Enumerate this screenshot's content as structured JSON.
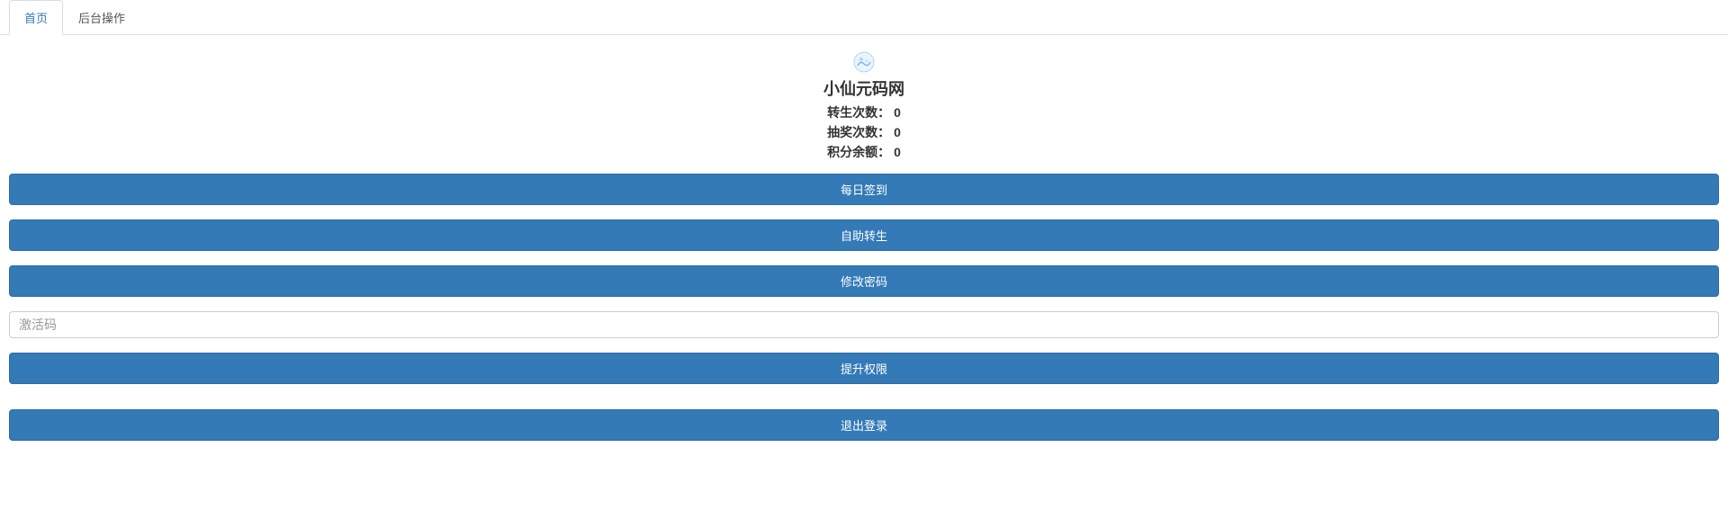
{
  "tabs": {
    "home_label": "首页",
    "admin_label": "后台操作"
  },
  "logo": {
    "name": "site-logo-icon"
  },
  "site_title": "小仙元码网",
  "stats": {
    "rebirth_label": "转生次数：",
    "rebirth_value": "0",
    "lottery_label": "抽奖次数：",
    "lottery_value": "0",
    "points_label": "积分余额：",
    "points_value": "0"
  },
  "buttons": {
    "daily_checkin": "每日签到",
    "self_rebirth": "自助转生",
    "change_password": "修改密码",
    "upgrade_privilege": "提升权限",
    "logout": "退出登录"
  },
  "inputs": {
    "activation_code_placeholder": "激活码"
  }
}
